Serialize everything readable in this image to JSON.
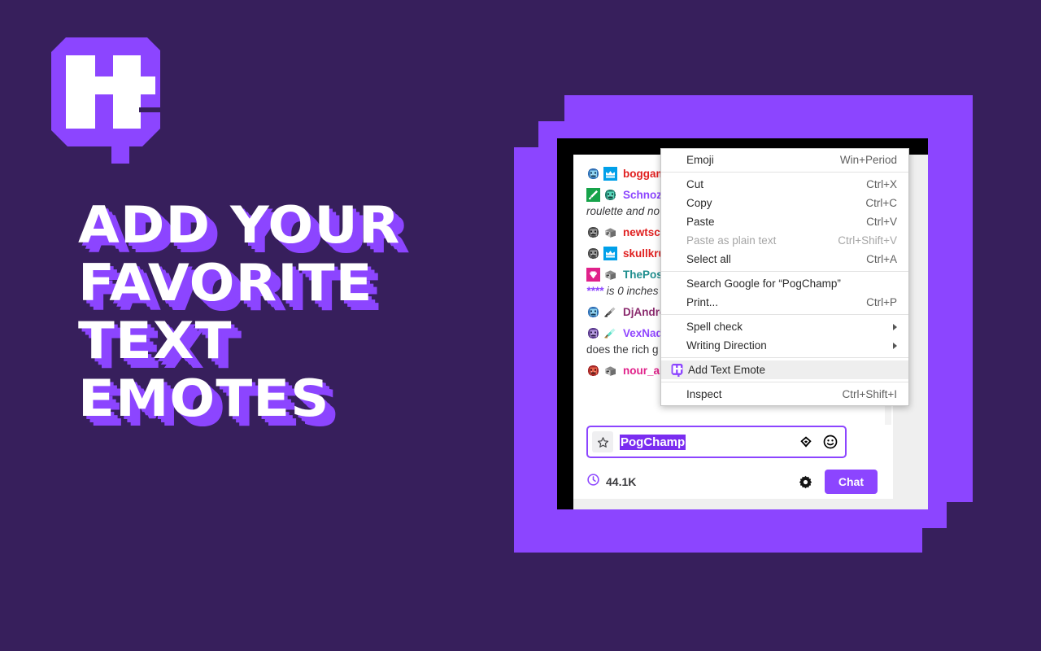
{
  "brand": {
    "logo_alt": "tt-logo",
    "headline_lines": [
      "Add your",
      "favorite",
      "text",
      "emotes"
    ]
  },
  "colors": {
    "background": "#371F5C",
    "accent_purple": "#8C45FF",
    "panel_border": "#000000",
    "chat_button": "#8C45FF",
    "selection": "#7A2DF0"
  },
  "chat": {
    "messages": [
      {
        "badges": [
          "blue-monster-avatar",
          "crown-badge"
        ],
        "username": "boggam",
        "name_color": "#e02020",
        "body": ""
      },
      {
        "badges": [
          "green-sword-badge",
          "teal-monster-avatar"
        ],
        "username": "Schnoze",
        "name_color": "#8c45ff",
        "body": "roulette and no",
        "italic": true
      },
      {
        "badges": [
          "grey-monster-avatar",
          "grey-box-badge"
        ],
        "username": "newtsca",
        "name_color": "#e02020",
        "body": ""
      },
      {
        "badges": [
          "grey-monster-avatar",
          "crown-badge"
        ],
        "username": "skullkru",
        "name_color": "#e02020",
        "body": ""
      },
      {
        "badges": [
          "pink-gem-badge",
          "grey-box-badge"
        ],
        "username": "ThePosi",
        "name_color": "#1f8f8f",
        "body": "**** is 0 inches",
        "italic": true,
        "body_prefix_stars": "****"
      },
      {
        "badges": [
          "blue-monster-avatar",
          "grey-sword-badge"
        ],
        "username": "DjAndre",
        "name_color": "#8a2a6d",
        "body": ""
      },
      {
        "badges": [
          "purple-monster-avatar",
          "teal-sword-badge"
        ],
        "username": "VexNad",
        "name_color": "#9147ff",
        "body": "does the rich g"
      },
      {
        "badges": [
          "red-monster-avatar",
          "grey-box-badge"
        ],
        "username": "nour_alm",
        "name_color": "#e0218a",
        "body": ""
      }
    ],
    "input": {
      "value": "PogChamp",
      "selected": true,
      "star_icon": "star-icon",
      "bits_icon": "bits-icon",
      "emote_icon": "emote-smiley-icon"
    },
    "bottom_bar": {
      "viewers_icon": "clock-icon",
      "viewers_count": "44.1K",
      "settings_icon": "gear-icon",
      "chat_button_label": "Chat"
    }
  },
  "context_menu": {
    "groups": [
      [
        {
          "label": "Emoji",
          "accel": "Win+Period",
          "icon": null,
          "disabled": false,
          "submenu": false,
          "highlight": false
        }
      ],
      [
        {
          "label": "Cut",
          "accel": "Ctrl+X",
          "icon": null,
          "disabled": false,
          "submenu": false,
          "highlight": false
        },
        {
          "label": "Copy",
          "accel": "Ctrl+C",
          "icon": null,
          "disabled": false,
          "submenu": false,
          "highlight": false
        },
        {
          "label": "Paste",
          "accel": "Ctrl+V",
          "icon": null,
          "disabled": false,
          "submenu": false,
          "highlight": false
        },
        {
          "label": "Paste as plain text",
          "accel": "Ctrl+Shift+V",
          "icon": null,
          "disabled": true,
          "submenu": false,
          "highlight": false
        },
        {
          "label": "Select all",
          "accel": "Ctrl+A",
          "icon": null,
          "disabled": false,
          "submenu": false,
          "highlight": false
        }
      ],
      [
        {
          "label": "Search Google for “PogChamp”",
          "accel": "",
          "icon": null,
          "disabled": false,
          "submenu": false,
          "highlight": false
        },
        {
          "label": "Print...",
          "accel": "Ctrl+P",
          "icon": null,
          "disabled": false,
          "submenu": false,
          "highlight": false
        }
      ],
      [
        {
          "label": "Spell check",
          "accel": "",
          "icon": null,
          "disabled": false,
          "submenu": true,
          "highlight": false
        },
        {
          "label": "Writing Direction",
          "accel": "",
          "icon": null,
          "disabled": false,
          "submenu": true,
          "highlight": false
        }
      ],
      [
        {
          "label": "Add Text Emote",
          "accel": "",
          "icon": "tt-logo-icon",
          "disabled": false,
          "submenu": false,
          "highlight": true
        }
      ],
      [
        {
          "label": "Inspect",
          "accel": "Ctrl+Shift+I",
          "icon": null,
          "disabled": false,
          "submenu": false,
          "highlight": false
        }
      ]
    ]
  }
}
